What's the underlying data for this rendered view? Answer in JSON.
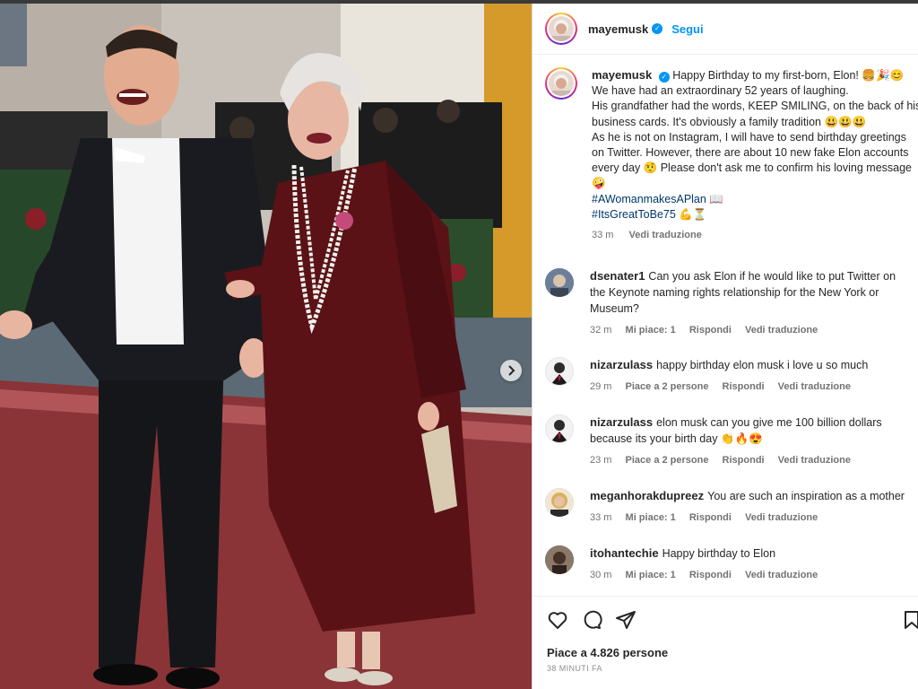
{
  "post": {
    "author": "mayemusk",
    "follow_label": "Segui",
    "caption_lines": [
      "Happy Birthday to my first-born, Elon! 🍔🎉😊",
      "We have had an extraordinary 52 years of laughing.",
      "His grandfather had the words, KEEP SMILING, on the back of his",
      "business cards. It's obviously a family tradition 😃😃😃",
      "As he is not on Instagram, I will have to send birthday greetings",
      "on Twitter. However, there are about 10 new fake Elon accounts",
      "every day 🤨 Please don't ask me to confirm his loving message",
      "🤪"
    ],
    "hashtags": [
      "#AWomanmakesAPlan 📖",
      "#ItsGreatToBe75 💪⏳"
    ],
    "caption_time": "33 m",
    "caption_translate": "Vedi traduzione"
  },
  "comments": [
    {
      "user": "dsenater1",
      "lines": [
        "Can you ask Elon if he would like to put Twitter on",
        "the Keynote naming rights relationship for the New York or",
        "Museum?"
      ],
      "time": "32 m",
      "likes": "Mi piace: 1",
      "reply": "Rispondi",
      "translate": "Vedi traduzione"
    },
    {
      "user": "nizarzulass",
      "lines": [
        "happy birthday elon musk i love u so much"
      ],
      "time": "29 m",
      "likes": "Piace a 2 persone",
      "reply": "Rispondi",
      "translate": "Vedi traduzione"
    },
    {
      "user": "nizarzulass",
      "lines": [
        "elon musk can you give me 100 billion dollars",
        "because its your birth day 👏🔥😍"
      ],
      "time": "23 m",
      "likes": "Piace a 2 persone",
      "reply": "Rispondi",
      "translate": "Vedi traduzione"
    },
    {
      "user": "meganhorakdupreez",
      "lines": [
        "You are such an inspiration as a mother"
      ],
      "time": "33 m",
      "likes": "Mi piace: 1",
      "reply": "Rispondi",
      "translate": "Vedi traduzione"
    },
    {
      "user": "itohantechie",
      "lines": [
        "Happy birthday to Elon"
      ],
      "time": "30 m",
      "likes": "Mi piace: 1",
      "reply": "Rispondi",
      "translate": "Vedi traduzione"
    }
  ],
  "footer": {
    "likes_text": "Piace a 4.826 persone",
    "posted_ago": "38 MINUTI FA"
  },
  "icons": {
    "like": "heart-icon",
    "comment": "comment-icon",
    "share": "share-icon",
    "save": "bookmark-icon",
    "next": "chevron-right-icon",
    "verified": "verified-badge-icon"
  },
  "colors": {
    "accent": "#0095f6",
    "hashtag": "#00376b",
    "secondary_text": "#737373"
  }
}
